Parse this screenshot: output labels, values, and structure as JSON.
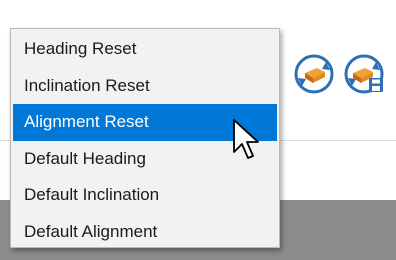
{
  "toolbar": {
    "buttons": [
      {
        "icon": "reset-view-icon"
      },
      {
        "icon": "reset-view-save-icon"
      }
    ]
  },
  "context_menu": {
    "items": [
      {
        "label": "Heading Reset",
        "selected": false
      },
      {
        "label": "Inclination Reset",
        "selected": false
      },
      {
        "label": "Alignment Reset",
        "selected": true
      },
      {
        "label": "Default Heading",
        "selected": false
      },
      {
        "label": "Default Inclination",
        "selected": false
      },
      {
        "label": "Default Alignment",
        "selected": false
      }
    ]
  },
  "colors": {
    "selection": "#0078d7",
    "menu_background": "#f2f2f2",
    "panel_gray": "#8c8c8c"
  }
}
